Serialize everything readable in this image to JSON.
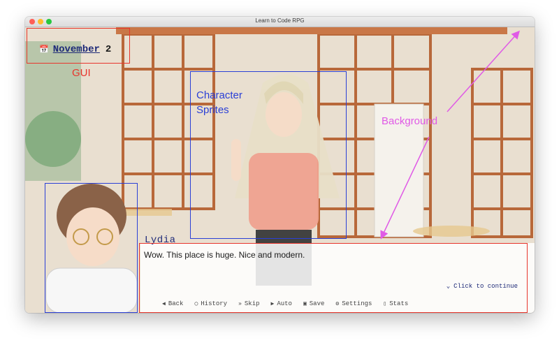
{
  "window": {
    "title": "Learn to Code RPG"
  },
  "hud": {
    "date_month": "November",
    "date_day": "2"
  },
  "dialogue": {
    "speaker": "Lydia",
    "text": "Wow. This place is huge. Nice and modern.",
    "continue_label": "Click to continue"
  },
  "quick_menu": [
    {
      "label": "Back",
      "icon": "back-icon"
    },
    {
      "label": "History",
      "icon": "history-icon"
    },
    {
      "label": "Skip",
      "icon": "skip-icon"
    },
    {
      "label": "Auto",
      "icon": "auto-icon"
    },
    {
      "label": "Save",
      "icon": "save-icon"
    },
    {
      "label": "Settings",
      "icon": "settings-icon"
    },
    {
      "label": "Stats",
      "icon": "stats-icon"
    }
  ],
  "annotations": {
    "gui": "GUI",
    "character_sprites_line1": "Character",
    "character_sprites_line2": "Sprites",
    "background": "Background"
  },
  "colors": {
    "gui_annotation": "#e8352c",
    "sprite_annotation": "#2a3fd6",
    "background_annotation": "#e05ae6",
    "dialog_text": "#1e2a78"
  }
}
